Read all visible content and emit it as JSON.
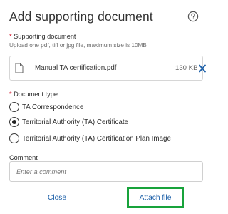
{
  "dialog": {
    "title": "Add supporting document",
    "help_icon": "question-circle-icon"
  },
  "supporting_document": {
    "label": "Supporting document",
    "required_marker": "*",
    "hint": "Upload one pdf, tiff or jpg file, maximum size is 10MB",
    "file": {
      "icon": "document-icon",
      "name": "Manual TA certification.pdf",
      "size": "130 KB",
      "remove_icon": "close-x-icon"
    }
  },
  "document_type": {
    "label": "Document type",
    "required_marker": "*",
    "options": [
      {
        "label": "TA Correspondence",
        "checked": false
      },
      {
        "label": "Territorial Authority (TA) Certificate",
        "checked": true
      },
      {
        "label": "Territorial Authority (TA) Certification Plan Image",
        "checked": false
      }
    ]
  },
  "comment": {
    "label": "Comment",
    "placeholder": "Enter a comment",
    "value": ""
  },
  "actions": {
    "close_label": "Close",
    "attach_label": "Attach file"
  },
  "colors": {
    "required": "#d0021b",
    "link": "#1b5fa8",
    "highlight_border": "#18a33b"
  }
}
